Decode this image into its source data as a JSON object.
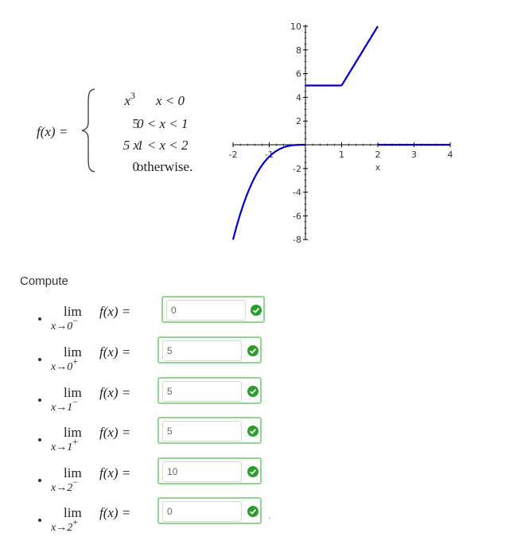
{
  "definition": {
    "lhs": "f(x) =",
    "cases": [
      {
        "expr_base": "x",
        "expr_sup": "3",
        "condition": "x < 0"
      },
      {
        "expr_base": "5",
        "expr_sup": "",
        "condition": "0 < x < 1"
      },
      {
        "expr_base": "5 x",
        "expr_sup": "",
        "condition": "1 < x < 2"
      },
      {
        "expr_base": "0",
        "expr_sup": "",
        "condition": "otherwise."
      }
    ]
  },
  "graph": {
    "type": "line",
    "xlabel": "x",
    "xlim": [
      -2,
      4
    ],
    "ylim": [
      -8,
      10
    ],
    "x_ticks": [
      "-2",
      "-1",
      "1",
      "2",
      "3",
      "4"
    ],
    "y_ticks": [
      "10",
      "8",
      "6",
      "4",
      "2",
      "-2",
      "-4",
      "-6",
      "-8"
    ],
    "line_color": "#0000cc",
    "axis_color": "#000000"
  },
  "compute": {
    "title": "Compute",
    "items": [
      {
        "lim": "lim",
        "sub_var": "x→0",
        "sub_dir": "−",
        "expr": "f(x) =",
        "answer": "0"
      },
      {
        "lim": "lim",
        "sub_var": "x→0",
        "sub_dir": "+",
        "expr": "f(x) =",
        "answer": "5"
      },
      {
        "lim": "lim",
        "sub_var": "x→1",
        "sub_dir": "−",
        "expr": "f(x) =",
        "answer": "5"
      },
      {
        "lim": "lim",
        "sub_var": "x→1",
        "sub_dir": "+",
        "expr": "f(x) =",
        "answer": "5"
      },
      {
        "lim": "lim",
        "sub_var": "x→2",
        "sub_dir": "−",
        "expr": "f(x) =",
        "answer": "10"
      },
      {
        "lim": "lim",
        "sub_var": "x→2",
        "sub_dir": "+",
        "expr": "f(x) =",
        "answer": "0"
      }
    ],
    "trailing": "."
  },
  "colors": {
    "correct_border": "#8fd68f",
    "correct_icon": "#2a9d2a"
  },
  "icons": {
    "status": "checkmark-circle-icon"
  }
}
